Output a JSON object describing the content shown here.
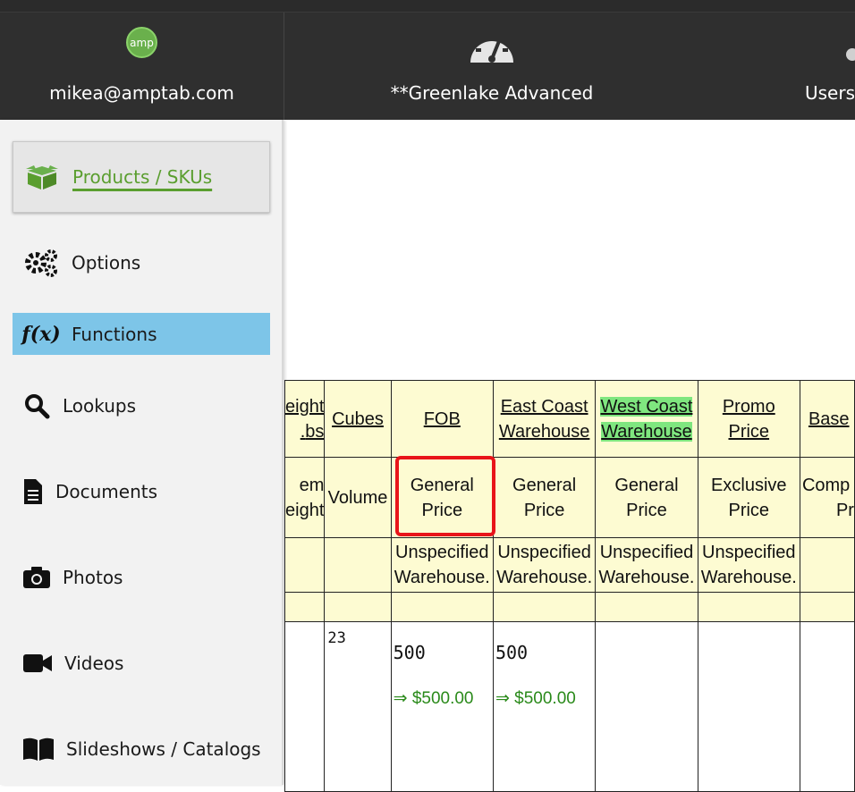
{
  "topbar": {
    "user_email": "mikea@amptab.com",
    "logo_text": "amp",
    "app_name": "**Greenlake Advanced",
    "users_label": "Users"
  },
  "sidebar": {
    "items": [
      {
        "label": "Products / SKUs",
        "icon": "box-icon"
      },
      {
        "label": "Options",
        "icon": "gears-icon"
      },
      {
        "label": "Functions",
        "icon": "function-icon",
        "icon_text": "f(x)"
      },
      {
        "label": "Lookups",
        "icon": "search-icon"
      },
      {
        "label": "Documents",
        "icon": "document-icon"
      },
      {
        "label": "Photos",
        "icon": "camera-icon"
      },
      {
        "label": "Videos",
        "icon": "video-icon"
      },
      {
        "label": "Slideshows / Catalogs",
        "icon": "book-icon"
      }
    ]
  },
  "table": {
    "headers": [
      {
        "line1": "eight",
        "line2": "bs."
      },
      {
        "line1": "Cubes",
        "line2": ""
      },
      {
        "line1": "FOB",
        "line2": ""
      },
      {
        "line1": "East Coast",
        "line2": "Warehouse"
      },
      {
        "line1": "West Coast",
        "line2": "Warehouse"
      },
      {
        "line1": "Promo",
        "line2": "Price"
      },
      {
        "line1": "Base",
        "line2": ""
      }
    ],
    "types": [
      {
        "line1": "em",
        "line2": "eight"
      },
      {
        "line1": "Volume",
        "line2": ""
      },
      {
        "line1": "General",
        "line2": "Price"
      },
      {
        "line1": "General",
        "line2": "Price"
      },
      {
        "line1": "General",
        "line2": "Price"
      },
      {
        "line1": "Exclusive",
        "line2": "Price"
      },
      {
        "line1": "Comp",
        "line2": "Pr"
      }
    ],
    "warehouses": [
      "",
      "",
      "Unspecified Warehouse.",
      "Unspecified Warehouse.",
      "Unspecified Warehouse.",
      "Unspecified Warehouse.",
      ""
    ],
    "row": {
      "cubes": "23",
      "fob_value": "500",
      "fob_price": "⇒ $500.00",
      "east_value": "500",
      "east_price": "⇒ $500.00"
    }
  },
  "colors": {
    "topbar": "#2f2f2f",
    "brand_green": "#5a9e2f",
    "functions_highlight": "#7dc5e8",
    "header_bg": "#fdfbd2",
    "west_coast_highlight": "#7fe67f",
    "annotation_red": "#e8141a"
  }
}
